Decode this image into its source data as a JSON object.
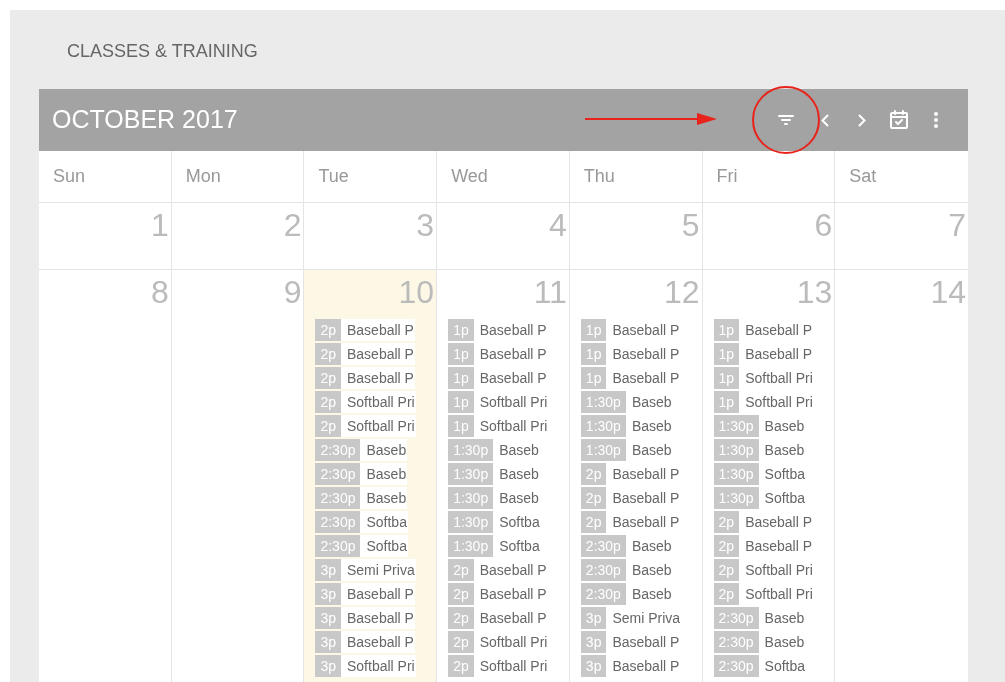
{
  "page_title": "CLASSES & TRAINING",
  "calendar": {
    "month": "OCTOBER 2017",
    "toolbar": [
      {
        "kind": "filter",
        "highlighted": true
      },
      {
        "kind": "prev",
        "highlighted": false
      },
      {
        "kind": "next",
        "highlighted": false
      },
      {
        "kind": "today",
        "highlighted": false
      },
      {
        "kind": "more",
        "highlighted": false
      }
    ],
    "weekdays": [
      "Sun",
      "Mon",
      "Tue",
      "Wed",
      "Thu",
      "Fri",
      "Sat"
    ],
    "weeks": [
      {
        "days": [
          {
            "number": "1",
            "selected": false
          },
          {
            "number": "2",
            "selected": false
          },
          {
            "number": "3",
            "selected": false
          },
          {
            "number": "4",
            "selected": false
          },
          {
            "number": "5",
            "selected": false
          },
          {
            "number": "6",
            "selected": false
          },
          {
            "number": "7",
            "selected": false
          }
        ]
      },
      {
        "days": [
          {
            "number": "8",
            "selected": false
          },
          {
            "number": "9",
            "selected": false
          },
          {
            "number": "10",
            "selected": true,
            "events": [
              {
                "time": "2p",
                "title": "Baseball P"
              },
              {
                "time": "2p",
                "title": "Baseball P"
              },
              {
                "time": "2p",
                "title": "Baseball P"
              },
              {
                "time": "2p",
                "title": "Softball Pri"
              },
              {
                "time": "2p",
                "title": "Softball Pri"
              },
              {
                "time": "2:30p",
                "title": "Baseb"
              },
              {
                "time": "2:30p",
                "title": "Baseb"
              },
              {
                "time": "2:30p",
                "title": "Baseb"
              },
              {
                "time": "2:30p",
                "title": "Softba"
              },
              {
                "time": "2:30p",
                "title": "Softba"
              },
              {
                "time": "3p",
                "title": "Semi Priva"
              },
              {
                "time": "3p",
                "title": "Baseball P"
              },
              {
                "time": "3p",
                "title": "Baseball P"
              },
              {
                "time": "3p",
                "title": "Baseball P"
              },
              {
                "time": "3p",
                "title": "Softball Pri"
              }
            ]
          },
          {
            "number": "11",
            "selected": false,
            "events": [
              {
                "time": "1p",
                "title": "Baseball P"
              },
              {
                "time": "1p",
                "title": "Baseball P"
              },
              {
                "time": "1p",
                "title": "Baseball P"
              },
              {
                "time": "1p",
                "title": "Softball Pri"
              },
              {
                "time": "1p",
                "title": "Softball Pri"
              },
              {
                "time": "1:30p",
                "title": "Baseb"
              },
              {
                "time": "1:30p",
                "title": "Baseb"
              },
              {
                "time": "1:30p",
                "title": "Baseb"
              },
              {
                "time": "1:30p",
                "title": "Softba"
              },
              {
                "time": "1:30p",
                "title": "Softba"
              },
              {
                "time": "2p",
                "title": "Baseball P"
              },
              {
                "time": "2p",
                "title": "Baseball P"
              },
              {
                "time": "2p",
                "title": "Baseball P"
              },
              {
                "time": "2p",
                "title": "Softball Pri"
              },
              {
                "time": "2p",
                "title": "Softball Pri"
              }
            ]
          },
          {
            "number": "12",
            "selected": false,
            "events": [
              {
                "time": "1p",
                "title": "Baseball P"
              },
              {
                "time": "1p",
                "title": "Baseball P"
              },
              {
                "time": "1p",
                "title": "Baseball P"
              },
              {
                "time": "1:30p",
                "title": "Baseb"
              },
              {
                "time": "1:30p",
                "title": "Baseb"
              },
              {
                "time": "1:30p",
                "title": "Baseb"
              },
              {
                "time": "2p",
                "title": "Baseball P"
              },
              {
                "time": "2p",
                "title": "Baseball P"
              },
              {
                "time": "2p",
                "title": "Baseball P"
              },
              {
                "time": "2:30p",
                "title": "Baseb"
              },
              {
                "time": "2:30p",
                "title": "Baseb"
              },
              {
                "time": "2:30p",
                "title": "Baseb"
              },
              {
                "time": "3p",
                "title": "Semi Priva"
              },
              {
                "time": "3p",
                "title": "Baseball P"
              },
              {
                "time": "3p",
                "title": "Baseball P"
              }
            ]
          },
          {
            "number": "13",
            "selected": false,
            "events": [
              {
                "time": "1p",
                "title": "Baseball P"
              },
              {
                "time": "1p",
                "title": "Baseball P"
              },
              {
                "time": "1p",
                "title": "Softball Pri"
              },
              {
                "time": "1p",
                "title": "Softball Pri"
              },
              {
                "time": "1:30p",
                "title": "Baseb"
              },
              {
                "time": "1:30p",
                "title": "Baseb"
              },
              {
                "time": "1:30p",
                "title": "Softba"
              },
              {
                "time": "1:30p",
                "title": "Softba"
              },
              {
                "time": "2p",
                "title": "Baseball P"
              },
              {
                "time": "2p",
                "title": "Baseball P"
              },
              {
                "time": "2p",
                "title": "Softball Pri"
              },
              {
                "time": "2p",
                "title": "Softball Pri"
              },
              {
                "time": "2:30p",
                "title": "Baseb"
              },
              {
                "time": "2:30p",
                "title": "Baseb"
              },
              {
                "time": "2:30p",
                "title": "Softba"
              }
            ]
          },
          {
            "number": "14",
            "selected": false
          }
        ]
      }
    ]
  }
}
